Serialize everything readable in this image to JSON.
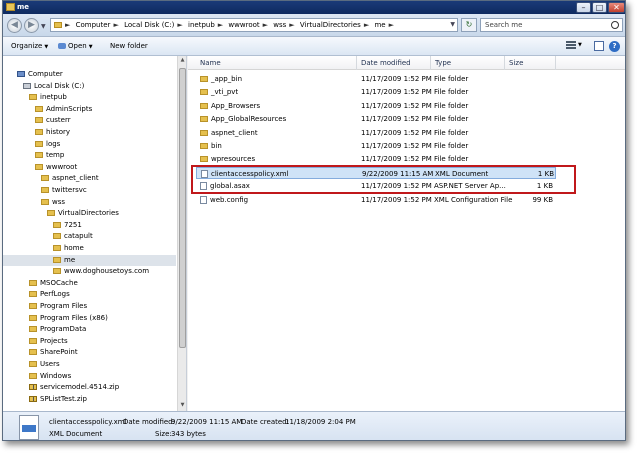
{
  "window": {
    "title": "me"
  },
  "address": {
    "crumbs": [
      "Computer",
      "Local Disk (C:)",
      "inetpub",
      "wwwroot",
      "wss",
      "VirtualDirectories",
      "me"
    ],
    "search_placeholder": "Search me"
  },
  "toolbar": {
    "organize": "Organize",
    "open": "Open",
    "new_folder": "New folder"
  },
  "nav": {
    "items": [
      {
        "label": "Computer",
        "icon": "computer-icon",
        "level": 0
      },
      {
        "label": "Local Disk (C:)",
        "icon": "drive-icon",
        "level": 1
      },
      {
        "label": "inetpub",
        "icon": "folder-icon",
        "level": 2
      },
      {
        "label": "AdminScripts",
        "icon": "folder-icon",
        "level": 3
      },
      {
        "label": "custerr",
        "icon": "folder-icon",
        "level": 3
      },
      {
        "label": "history",
        "icon": "folder-icon",
        "level": 3
      },
      {
        "label": "logs",
        "icon": "folder-icon",
        "level": 3
      },
      {
        "label": "temp",
        "icon": "folder-icon",
        "level": 3
      },
      {
        "label": "wwwroot",
        "icon": "folder-icon",
        "level": 3
      },
      {
        "label": "aspnet_client",
        "icon": "folder-icon",
        "level": 4
      },
      {
        "label": "twittersvc",
        "icon": "folder-icon",
        "level": 4
      },
      {
        "label": "wss",
        "icon": "folder-icon",
        "level": 4
      },
      {
        "label": "VirtualDirectories",
        "icon": "folder-icon",
        "level": 5
      },
      {
        "label": "7251",
        "icon": "folder-icon",
        "level": 6
      },
      {
        "label": "catapult",
        "icon": "folder-icon",
        "level": 6
      },
      {
        "label": "home",
        "icon": "folder-icon",
        "level": 6
      },
      {
        "label": "me",
        "icon": "folder-icon",
        "level": 6,
        "selected": true
      },
      {
        "label": "www.doghousetoys.com",
        "icon": "folder-icon",
        "level": 6
      },
      {
        "label": "MSOCache",
        "icon": "folder-icon",
        "level": 2
      },
      {
        "label": "PerfLogs",
        "icon": "folder-icon",
        "level": 2
      },
      {
        "label": "Program Files",
        "icon": "folder-icon",
        "level": 2
      },
      {
        "label": "Program Files (x86)",
        "icon": "folder-icon",
        "level": 2
      },
      {
        "label": "ProgramData",
        "icon": "folder-icon",
        "level": 2
      },
      {
        "label": "Projects",
        "icon": "folder-icon",
        "level": 2
      },
      {
        "label": "SharePoint",
        "icon": "folder-icon",
        "level": 2
      },
      {
        "label": "Users",
        "icon": "folder-icon",
        "level": 2
      },
      {
        "label": "Windows",
        "icon": "folder-icon",
        "level": 2
      },
      {
        "label": "servicemodel.4514.zip",
        "icon": "zip-icon",
        "level": 2
      },
      {
        "label": "SPListTest.zip",
        "icon": "zip-icon",
        "level": 2
      }
    ]
  },
  "files": {
    "columns": {
      "name": "Name",
      "date": "Date modified",
      "type": "Type",
      "size": "Size"
    },
    "rows": [
      {
        "name": "_app_bin",
        "date": "11/17/2009 1:52 PM",
        "type": "File folder",
        "size": "",
        "icon": "folder-icon"
      },
      {
        "name": "_vti_pvt",
        "date": "11/17/2009 1:52 PM",
        "type": "File folder",
        "size": "",
        "icon": "folder-icon"
      },
      {
        "name": "App_Browsers",
        "date": "11/17/2009 1:52 PM",
        "type": "File folder",
        "size": "",
        "icon": "folder-icon"
      },
      {
        "name": "App_GlobalResources",
        "date": "11/17/2009 1:52 PM",
        "type": "File folder",
        "size": "",
        "icon": "folder-icon"
      },
      {
        "name": "aspnet_client",
        "date": "11/17/2009 1:52 PM",
        "type": "File folder",
        "size": "",
        "icon": "folder-icon"
      },
      {
        "name": "bin",
        "date": "11/17/2009 1:52 PM",
        "type": "File folder",
        "size": "",
        "icon": "folder-icon"
      },
      {
        "name": "wpresources",
        "date": "11/17/2009 1:52 PM",
        "type": "File folder",
        "size": "",
        "icon": "folder-icon"
      },
      {
        "name": "clientaccesspolicy.xml",
        "date": "9/22/2009 11:15 AM",
        "type": "XML Document",
        "size": "1 KB",
        "icon": "xml-document-icon",
        "selected": true
      },
      {
        "name": "global.asax",
        "date": "11/17/2009 1:52 PM",
        "type": "ASP.NET Server Ap...",
        "size": "1 KB",
        "icon": "asax-file-icon"
      },
      {
        "name": "web.config",
        "date": "11/17/2009 1:52 PM",
        "type": "XML Configuration File",
        "size": "99 KB",
        "icon": "config-file-icon"
      }
    ]
  },
  "status": {
    "filename": "clientaccesspolicy.xml",
    "date_modified_label": "Date modified:",
    "date_modified": "9/22/2009 11:15 AM",
    "date_created_label": "Date created:",
    "date_created": "11/18/2009 2:04 PM",
    "type": "XML Document",
    "size_label": "Size:",
    "size": "343 bytes"
  },
  "colors": {
    "highlight_box": "#c0181b",
    "selection": "#cfe3f7"
  }
}
